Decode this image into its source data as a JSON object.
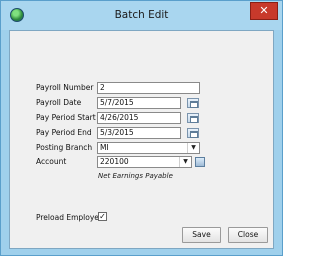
{
  "window": {
    "title": "Batch Edit",
    "close_label": "✕"
  },
  "form": {
    "payroll_number": {
      "label": "Payroll Number",
      "value": "2"
    },
    "payroll_date": {
      "label": "Payroll Date",
      "value": "5/7/2015"
    },
    "pay_period_start": {
      "label": "Pay Period Start",
      "value": "4/26/2015"
    },
    "pay_period_end": {
      "label": "Pay Period End",
      "value": "5/3/2015"
    },
    "posting_branch": {
      "label": "Posting Branch",
      "value": "MI",
      "arrow": "▼"
    },
    "account": {
      "label": "Account",
      "value": "220100",
      "arrow": "▼",
      "description": "Net Earnings Payable"
    },
    "preload_employees": {
      "label": "Preload Employees",
      "checked": "✓"
    }
  },
  "buttons": {
    "save": "Save",
    "close": "Close"
  },
  "icons": {
    "app": "green-globe-icon",
    "calendar": "calendar-icon",
    "lookup": "lookup-icon"
  }
}
